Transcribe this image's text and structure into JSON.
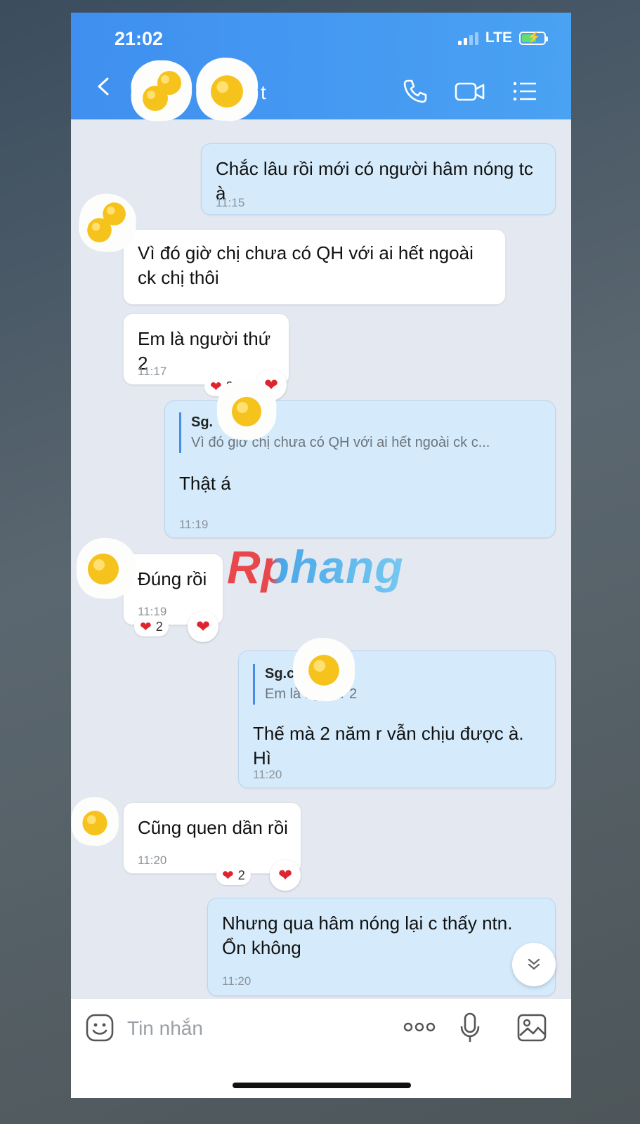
{
  "status_bar": {
    "time": "21:02",
    "network": "LTE"
  },
  "header": {
    "title_fragment": "t"
  },
  "messages": [
    {
      "dir": "out",
      "text": "Chắc lâu rồi mới có người hâm nóng tc à",
      "time": "11:15"
    },
    {
      "dir": "in",
      "text": "Vì đó giờ chị chưa có QH với ai hết ngoài ck chị thôi"
    },
    {
      "dir": "in",
      "text": "Em là người thứ 2",
      "time": "11:17",
      "reaction_count": "2"
    },
    {
      "dir": "out",
      "quote_name": "Sg.",
      "quote_name_tail": "t",
      "quote_text": "Vì đó giờ chị chưa có QH với ai hết ngoài ck c...",
      "text": "Thật á",
      "time": "11:19"
    },
    {
      "dir": "in",
      "text": "Đúng rồi",
      "time": "11:19",
      "reaction_count": "2"
    },
    {
      "dir": "out",
      "quote_name": "Sg.c",
      "quote_name_tail": "t",
      "quote_text": "Em là ng   thứ 2",
      "text": "Thế mà 2 năm r vẫn chịu được à. Hì",
      "time": "11:20"
    },
    {
      "dir": "in",
      "text": "Cũng quen dần rồi",
      "time": "11:20",
      "reaction_count": "2"
    },
    {
      "dir": "out",
      "text": "Nhưng qua hâm nóng lại c thấy ntn. Ổn không",
      "time": "11:20"
    }
  ],
  "watermark": "Rphang",
  "input": {
    "placeholder": "Tin nhắn"
  },
  "icons": {
    "back": "chevron-left-icon",
    "call": "phone-icon",
    "video": "video-camera-icon",
    "menu": "list-icon",
    "sticker": "smiley-icon",
    "more": "more-dots-icon",
    "mic": "microphone-icon",
    "image": "image-icon",
    "scroll": "chevron-double-down-icon",
    "reaction": "heart-icon"
  },
  "colors": {
    "header": "#3f8ff0",
    "outgoing_bubble": "#d5ebfb",
    "incoming_bubble": "#ffffff",
    "heart": "#e0242f"
  }
}
